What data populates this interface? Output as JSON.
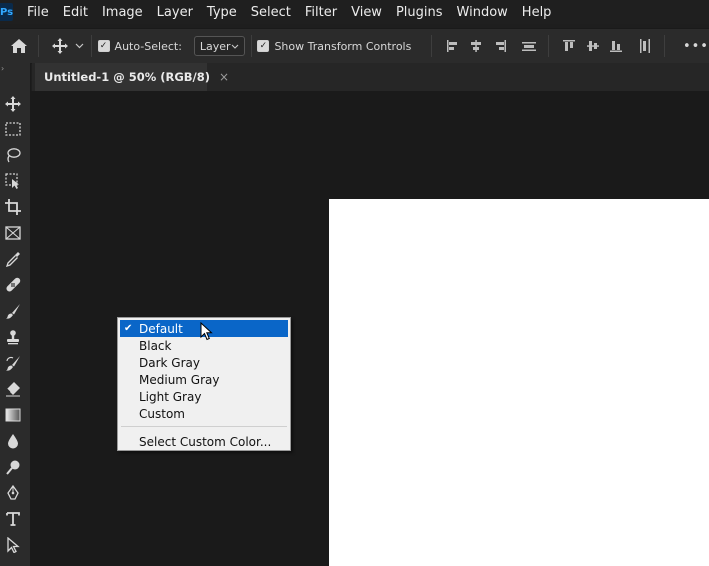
{
  "menubar": {
    "logo": "Ps",
    "items": [
      "File",
      "Edit",
      "Image",
      "Layer",
      "Type",
      "Select",
      "Filter",
      "View",
      "Plugins",
      "Window",
      "Help"
    ]
  },
  "options": {
    "auto_select_label": "Auto-Select:",
    "auto_select_checked": true,
    "layer_value": "Layer",
    "show_transform_label": "Show Transform Controls",
    "show_transform_checked": true,
    "more_label": "•••"
  },
  "document_tab": {
    "title": "Untitled-1 @ 50% (RGB/8)",
    "close": "×"
  },
  "context_menu": {
    "items": [
      {
        "label": "Default",
        "checked": true,
        "highlighted": true
      },
      {
        "label": "Black"
      },
      {
        "label": "Dark Gray"
      },
      {
        "label": "Medium Gray"
      },
      {
        "label": "Light Gray"
      },
      {
        "label": "Custom"
      }
    ],
    "footer_item": "Select Custom Color..."
  },
  "colors": {
    "accent_highlight": "#0a66c8",
    "canvas_background": "#1a1a1a",
    "document_fill": "#ffffff"
  }
}
